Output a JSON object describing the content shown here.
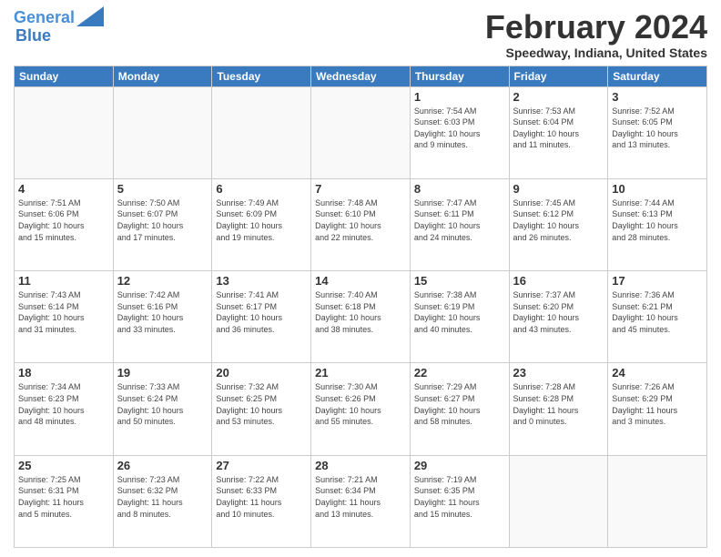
{
  "header": {
    "logo_line1": "General",
    "logo_line2": "Blue",
    "month": "February 2024",
    "location": "Speedway, Indiana, United States"
  },
  "days_of_week": [
    "Sunday",
    "Monday",
    "Tuesday",
    "Wednesday",
    "Thursday",
    "Friday",
    "Saturday"
  ],
  "weeks": [
    [
      {
        "day": "",
        "info": ""
      },
      {
        "day": "",
        "info": ""
      },
      {
        "day": "",
        "info": ""
      },
      {
        "day": "",
        "info": ""
      },
      {
        "day": "1",
        "info": "Sunrise: 7:54 AM\nSunset: 6:03 PM\nDaylight: 10 hours\nand 9 minutes."
      },
      {
        "day": "2",
        "info": "Sunrise: 7:53 AM\nSunset: 6:04 PM\nDaylight: 10 hours\nand 11 minutes."
      },
      {
        "day": "3",
        "info": "Sunrise: 7:52 AM\nSunset: 6:05 PM\nDaylight: 10 hours\nand 13 minutes."
      }
    ],
    [
      {
        "day": "4",
        "info": "Sunrise: 7:51 AM\nSunset: 6:06 PM\nDaylight: 10 hours\nand 15 minutes."
      },
      {
        "day": "5",
        "info": "Sunrise: 7:50 AM\nSunset: 6:07 PM\nDaylight: 10 hours\nand 17 minutes."
      },
      {
        "day": "6",
        "info": "Sunrise: 7:49 AM\nSunset: 6:09 PM\nDaylight: 10 hours\nand 19 minutes."
      },
      {
        "day": "7",
        "info": "Sunrise: 7:48 AM\nSunset: 6:10 PM\nDaylight: 10 hours\nand 22 minutes."
      },
      {
        "day": "8",
        "info": "Sunrise: 7:47 AM\nSunset: 6:11 PM\nDaylight: 10 hours\nand 24 minutes."
      },
      {
        "day": "9",
        "info": "Sunrise: 7:45 AM\nSunset: 6:12 PM\nDaylight: 10 hours\nand 26 minutes."
      },
      {
        "day": "10",
        "info": "Sunrise: 7:44 AM\nSunset: 6:13 PM\nDaylight: 10 hours\nand 28 minutes."
      }
    ],
    [
      {
        "day": "11",
        "info": "Sunrise: 7:43 AM\nSunset: 6:14 PM\nDaylight: 10 hours\nand 31 minutes."
      },
      {
        "day": "12",
        "info": "Sunrise: 7:42 AM\nSunset: 6:16 PM\nDaylight: 10 hours\nand 33 minutes."
      },
      {
        "day": "13",
        "info": "Sunrise: 7:41 AM\nSunset: 6:17 PM\nDaylight: 10 hours\nand 36 minutes."
      },
      {
        "day": "14",
        "info": "Sunrise: 7:40 AM\nSunset: 6:18 PM\nDaylight: 10 hours\nand 38 minutes."
      },
      {
        "day": "15",
        "info": "Sunrise: 7:38 AM\nSunset: 6:19 PM\nDaylight: 10 hours\nand 40 minutes."
      },
      {
        "day": "16",
        "info": "Sunrise: 7:37 AM\nSunset: 6:20 PM\nDaylight: 10 hours\nand 43 minutes."
      },
      {
        "day": "17",
        "info": "Sunrise: 7:36 AM\nSunset: 6:21 PM\nDaylight: 10 hours\nand 45 minutes."
      }
    ],
    [
      {
        "day": "18",
        "info": "Sunrise: 7:34 AM\nSunset: 6:23 PM\nDaylight: 10 hours\nand 48 minutes."
      },
      {
        "day": "19",
        "info": "Sunrise: 7:33 AM\nSunset: 6:24 PM\nDaylight: 10 hours\nand 50 minutes."
      },
      {
        "day": "20",
        "info": "Sunrise: 7:32 AM\nSunset: 6:25 PM\nDaylight: 10 hours\nand 53 minutes."
      },
      {
        "day": "21",
        "info": "Sunrise: 7:30 AM\nSunset: 6:26 PM\nDaylight: 10 hours\nand 55 minutes."
      },
      {
        "day": "22",
        "info": "Sunrise: 7:29 AM\nSunset: 6:27 PM\nDaylight: 10 hours\nand 58 minutes."
      },
      {
        "day": "23",
        "info": "Sunrise: 7:28 AM\nSunset: 6:28 PM\nDaylight: 11 hours\nand 0 minutes."
      },
      {
        "day": "24",
        "info": "Sunrise: 7:26 AM\nSunset: 6:29 PM\nDaylight: 11 hours\nand 3 minutes."
      }
    ],
    [
      {
        "day": "25",
        "info": "Sunrise: 7:25 AM\nSunset: 6:31 PM\nDaylight: 11 hours\nand 5 minutes."
      },
      {
        "day": "26",
        "info": "Sunrise: 7:23 AM\nSunset: 6:32 PM\nDaylight: 11 hours\nand 8 minutes."
      },
      {
        "day": "27",
        "info": "Sunrise: 7:22 AM\nSunset: 6:33 PM\nDaylight: 11 hours\nand 10 minutes."
      },
      {
        "day": "28",
        "info": "Sunrise: 7:21 AM\nSunset: 6:34 PM\nDaylight: 11 hours\nand 13 minutes."
      },
      {
        "day": "29",
        "info": "Sunrise: 7:19 AM\nSunset: 6:35 PM\nDaylight: 11 hours\nand 15 minutes."
      },
      {
        "day": "",
        "info": ""
      },
      {
        "day": "",
        "info": ""
      }
    ]
  ]
}
